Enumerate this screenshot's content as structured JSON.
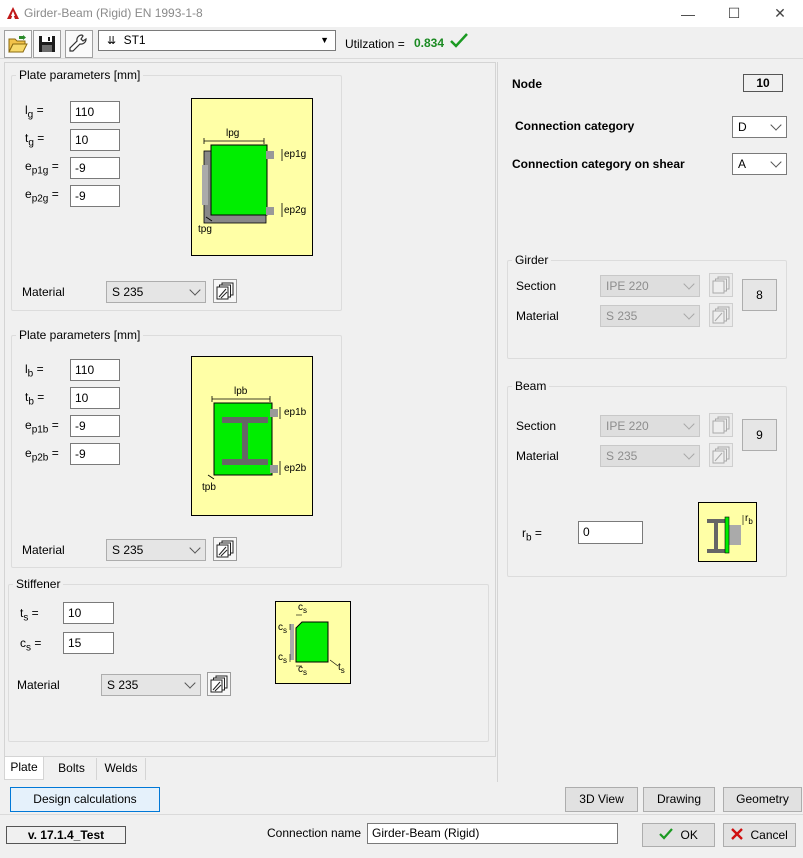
{
  "window": {
    "title": "Girder-Beam (Rigid) EN 1993-1-8",
    "minimize": "—",
    "maximize": "☐",
    "close": "✕"
  },
  "toolbar": {
    "scheme": "ST1",
    "scheme_prefix": "⇊",
    "utilization_label": "Utilzation =",
    "utilization_value": "0.834"
  },
  "plate_girder": {
    "title": "Plate parameters [mm]",
    "lg_label": "l",
    "lg_sub": "g",
    "lg": "110",
    "tg_label": "t",
    "tg_sub": "g",
    "tg": "10",
    "ep1g_label": "e",
    "ep1g_sub": "p1g",
    "ep1g": "-9",
    "ep2g_label": "e",
    "ep2g_sub": "p2g",
    "ep2g": "-9",
    "material_label": "Material",
    "material": "S 235",
    "diagram": {
      "top": "lpg",
      "r1": "ep1g",
      "r2": "ep2g",
      "bottom": "tpg"
    }
  },
  "plate_beam": {
    "title": "Plate parameters [mm]",
    "lb_label": "l",
    "lb_sub": "b",
    "lb": "110",
    "tb_label": "t",
    "tb_sub": "b",
    "tb": "10",
    "ep1b_label": "e",
    "ep1b_sub": "p1b",
    "ep1b": "-9",
    "ep2b_label": "e",
    "ep2b_sub": "p2b",
    "ep2b": "-9",
    "material_label": "Material",
    "material": "S 235",
    "diagram": {
      "top": "lpb",
      "r1": "ep1b",
      "r2": "ep2b",
      "bottom": "tpb"
    }
  },
  "stiffener": {
    "title": "Stiffener",
    "ts_label": "t",
    "ts_sub": "s",
    "ts": "10",
    "cs_label": "c",
    "cs_sub": "s",
    "cs": "15",
    "material_label": "Material",
    "material": "S 235",
    "diagram": {
      "c": "c",
      "c_sub": "s",
      "t": "t",
      "t_sub": "s"
    }
  },
  "right": {
    "node_label": "Node",
    "node_value": "10",
    "cat_label": "Connection category",
    "cat_value": "D",
    "shear_label": "Connection category on shear",
    "shear_value": "A"
  },
  "girder": {
    "title": "Girder",
    "section_label": "Section",
    "section": "IPE 220",
    "material_label": "Material",
    "material": "S 235",
    "id": "8"
  },
  "beam": {
    "title": "Beam",
    "section_label": "Section",
    "section": "IPE 220",
    "material_label": "Material",
    "material": "S 235",
    "id": "9",
    "rb_label": "r",
    "rb_sub": "b",
    "rb": "0",
    "diagram": {
      "r": "r",
      "r_sub": "b"
    }
  },
  "tabs": {
    "plate": "Plate",
    "bolts": "Bolts",
    "welds": "Welds"
  },
  "buttons": {
    "design_calc": "Design calculations",
    "view3d": "3D View",
    "drawing": "Drawing",
    "geometry": "Geometry",
    "ok": "OK",
    "cancel": "Cancel"
  },
  "footer": {
    "version": "v. 17.1.4_Test",
    "conn_name_label": "Connection name",
    "conn_name": "Girder-Beam (Rigid)"
  },
  "colors": {
    "diagram_bg": "#ffffa6",
    "plate_green": "#00ee00",
    "ok_green": "#1b8a22",
    "cancel_red": "#d01010"
  }
}
